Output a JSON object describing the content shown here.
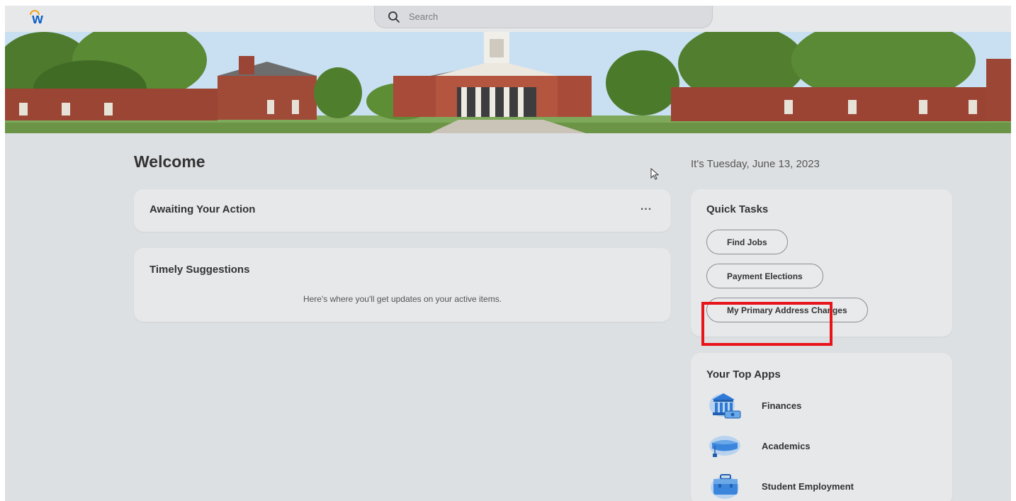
{
  "header": {
    "logo_letter": "w",
    "search_placeholder": "Search"
  },
  "main": {
    "welcome_title": "Welcome",
    "date_text": "It's Tuesday, June 13, 2023",
    "awaiting": {
      "title": "Awaiting Your Action",
      "more_label": "..."
    },
    "timely": {
      "title": "Timely Suggestions",
      "message": "Here's where you'll get updates on your active items."
    }
  },
  "quick_tasks": {
    "title": "Quick Tasks",
    "items": [
      "Find Jobs",
      "Payment Elections",
      "My Primary Address Changes"
    ]
  },
  "top_apps": {
    "title": "Your Top Apps",
    "items": [
      {
        "label": "Finances",
        "icon": "bank-icon"
      },
      {
        "label": "Academics",
        "icon": "graduation-cap-icon"
      },
      {
        "label": "Student Employment",
        "icon": "briefcase-icon"
      }
    ]
  },
  "colors": {
    "brand_blue": "#0b5fc6",
    "brand_orange": "#f0a526",
    "highlight_red": "#e8141b",
    "background": "#dde0e2",
    "card": "#e7e8ea"
  }
}
